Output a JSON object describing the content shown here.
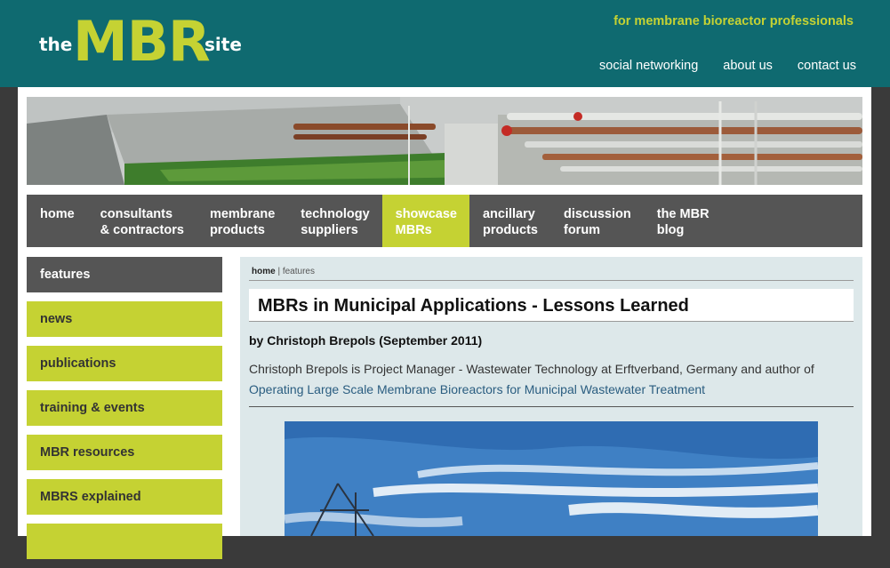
{
  "header": {
    "logo": {
      "the": "the",
      "mbr": "MBR",
      "site": "site"
    },
    "tagline": "for membrane bioreactor professionals",
    "topnav": [
      "social networking",
      "about us",
      "contact us"
    ]
  },
  "mainnav": [
    {
      "label": "home",
      "active": false
    },
    {
      "label": "consultants\n& contractors",
      "active": false
    },
    {
      "label": "membrane\nproducts",
      "active": false
    },
    {
      "label": "technology\nsuppliers",
      "active": false
    },
    {
      "label": "showcase\nMBRs",
      "active": true
    },
    {
      "label": "ancillary\nproducts",
      "active": false
    },
    {
      "label": "discussion\nforum",
      "active": false
    },
    {
      "label": "the MBR\nblog",
      "active": false
    }
  ],
  "sidebar": {
    "items": [
      "features",
      "news",
      "publications",
      "training & events",
      "MBR resources",
      "MBRS explained",
      ""
    ]
  },
  "breadcrumb": {
    "home": "home",
    "separator": "|",
    "current": "features"
  },
  "article": {
    "title": "MBRs in Municipal Applications - Lessons Learned",
    "byline": "by Christoph Brepols (September 2011)",
    "intro": "Christoph Brepols is Project Manager - Wastewater Technology at Erftverband, Germany and author of",
    "book_link": "Operating Large Scale Membrane Bioreactors for Municipal Wastewater Treatment"
  },
  "colors": {
    "header_bg": "#0f6a70",
    "accent": "#c5d233",
    "nav_bg": "#555555",
    "content_bg": "#dde8ea"
  }
}
